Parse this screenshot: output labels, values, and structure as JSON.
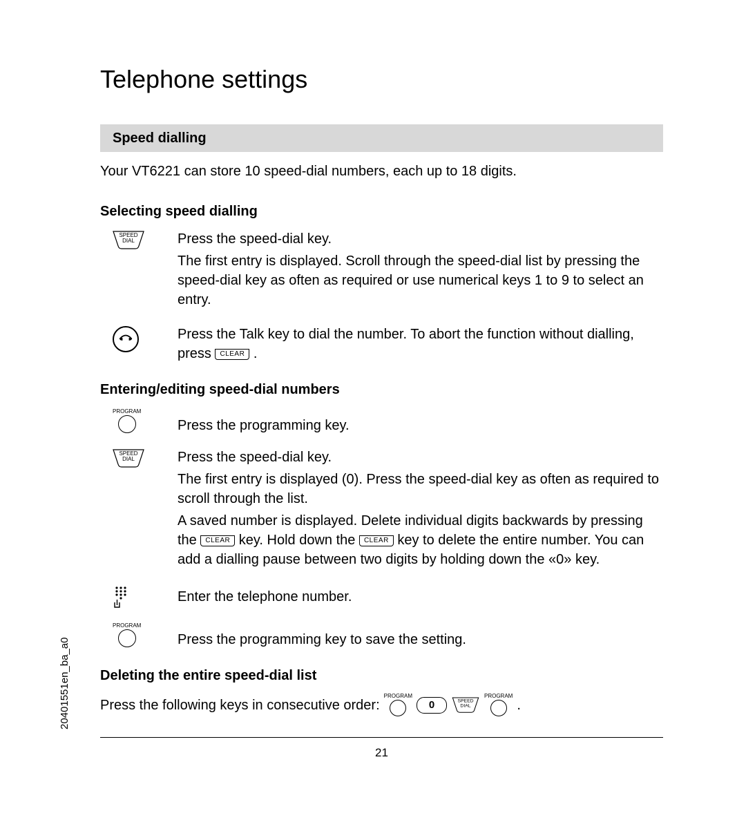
{
  "title": "Telephone settings",
  "section_bar": "Speed dialling",
  "intro": "Your VT6221 can store 10 speed-dial numbers, each up to 18 digits.",
  "subhead_selecting": "Selecting speed dialling",
  "speed_dial_label": "SPEED DIAL",
  "program_label": "PROGRAM",
  "clear_label": "CLEAR",
  "zero_label": "0",
  "sel_row1_a": "Press the speed-dial key.",
  "sel_row1_b": "The first entry is displayed. Scroll through the speed-dial list by pressing the speed-dial key as often as required or use numerical keys 1 to 9 to select an entry.",
  "sel_row2_a": "Press the Talk key to dial the number. To abort the function without dialling, press ",
  "sel_row2_b": " .",
  "subhead_entering": "Entering/editing speed-dial numbers",
  "ent_row1": "Press the programming key.",
  "ent_row2_a": "Press the speed-dial key.",
  "ent_row2_b": "The first entry is displayed (0). Press the speed-dial key as often as required to scroll through the list.",
  "ent_row2_c_pre": "A saved number is displayed. Delete individual digits backwards by pressing the ",
  "ent_row2_c_mid": " key. Hold down the ",
  "ent_row2_c_post": " key to delete the entire number. You can add a dialling pause between two digits by holding down the «0» key.",
  "ent_row3": "Enter the telephone number.",
  "ent_row4": "Press the programming key to save the setting.",
  "subhead_deleting": "Deleting the entire speed-dial list",
  "del_text": "Press the following keys in consecutive order: ",
  "del_end": ".",
  "page_number": "21",
  "side_ref": "20401551en_ba_a0"
}
